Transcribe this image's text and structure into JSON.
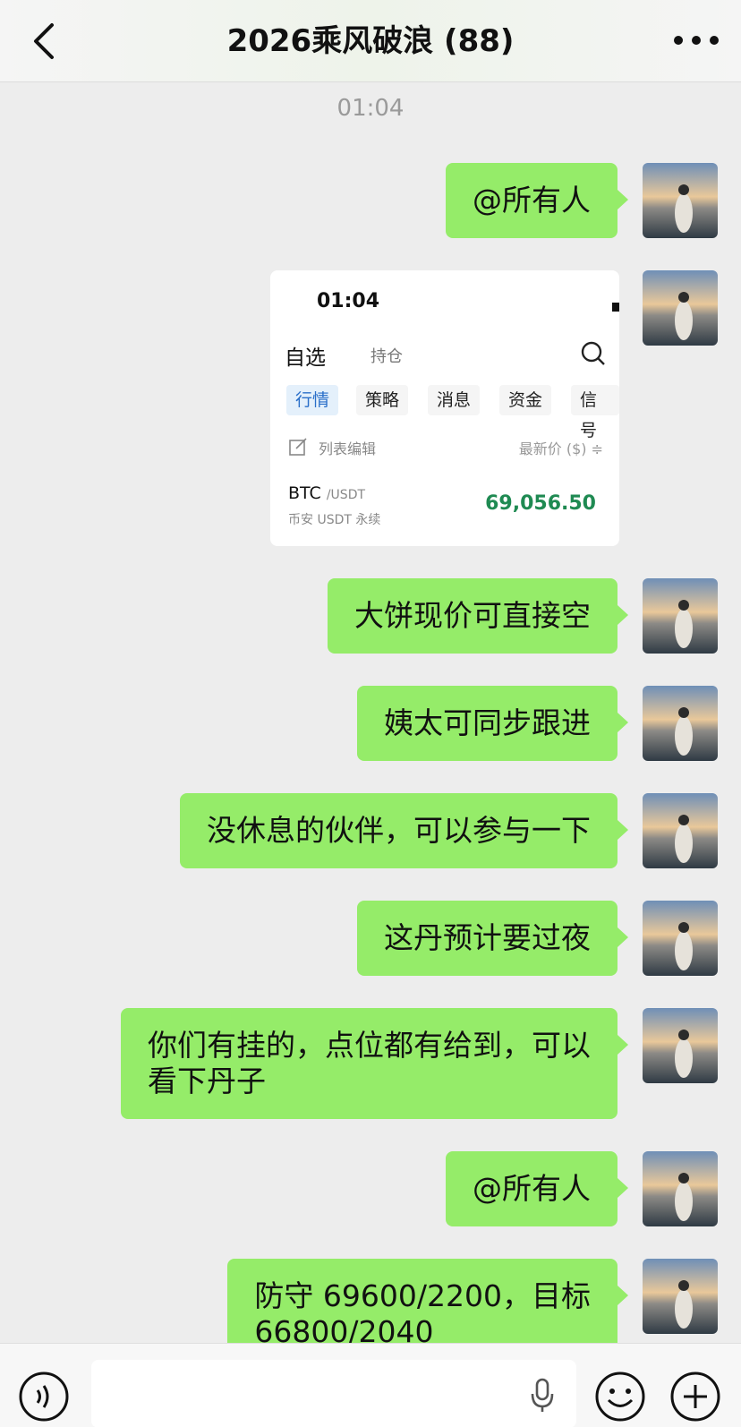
{
  "header": {
    "title": "2026乘风破浪 (88)",
    "back_icon": "chevron-left-icon",
    "more_icon": "more-dots-icon"
  },
  "timestamp": "01:04",
  "messages": [
    {
      "type": "text",
      "text": "@所有人"
    },
    {
      "type": "screenshot",
      "shot": {
        "time": "01:04",
        "tab_selected": "自选",
        "tab_other": "持仓",
        "filters": [
          "行情",
          "策略",
          "消息",
          "资金",
          "信号"
        ],
        "edit_label": "列表编辑",
        "price_header": "最新价 ($) ≑",
        "coin": "BTC",
        "pair": "/USDT",
        "coin_sub": "币安 USDT 永续",
        "price": "69,056.50",
        "price_color": "#1f8a52"
      }
    },
    {
      "type": "text",
      "text": "大饼现价可直接空"
    },
    {
      "type": "text",
      "text": "姨太可同步跟进"
    },
    {
      "type": "text",
      "text": "没休息的伙伴，可以参与一下"
    },
    {
      "type": "text",
      "text": "这丹预计要过夜"
    },
    {
      "type": "text",
      "line1": "你们有挂的，点位都有给到，可以",
      "line2": "看下丹子"
    },
    {
      "type": "text",
      "text": "@所有人"
    },
    {
      "type": "text",
      "line1": "防守 69600/2200，目标",
      "line2": "66800/2040"
    }
  ],
  "footer": {
    "voice_icon": "voice-icon",
    "mic_icon": "mic-icon",
    "emoji_icon": "emoji-icon",
    "plus_icon": "plus-icon"
  },
  "colors": {
    "bubble": "#95ec69",
    "background": "#ededed"
  }
}
